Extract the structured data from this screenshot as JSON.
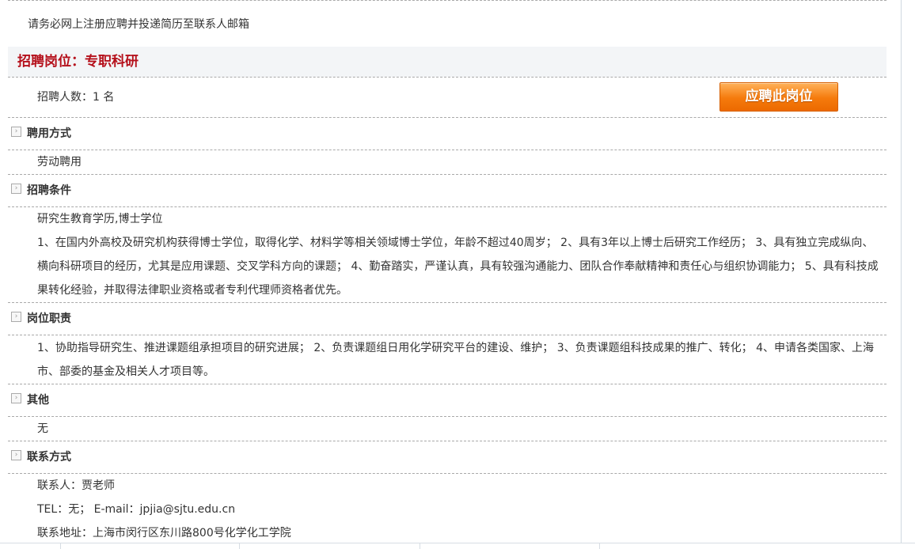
{
  "notice": "请务必网上注册应聘并投递简历至联系人邮箱",
  "job": {
    "title": "招聘岗位：专职科研",
    "count": "招聘人数：1 名",
    "apply_button": "应聘此岗位"
  },
  "sections": {
    "employment": {
      "heading": "聘用方式",
      "text": "劳动聘用"
    },
    "conditions": {
      "heading": "招聘条件",
      "degree": "研究生教育学历,博士学位",
      "text": "1、在国内外高校及研究机构获得博士学位，取得化学、材料学等相关领域博士学位，年龄不超过40周岁； 2、具有3年以上博士后研究工作经历； 3、具有独立完成纵向、横向科研项目的经历，尤其是应用课题、交叉学科方向的课题； 4、勤奋踏实，严谨认真，具有较强沟通能力、团队合作奉献精神和责任心与组织协调能力； 5、具有科技成果转化经验，并取得法律职业资格或者专利代理师资格者优先。"
    },
    "duties": {
      "heading": "岗位职责",
      "text": "1、协助指导研究生、推进课题组承担项目的研究进展； 2、负责课题组日用化学研究平台的建设、维护； 3、负责课题组科技成果的推广、转化； 4、申请各类国家、上海市、部委的基金及相关人才项目等。"
    },
    "other": {
      "heading": "其他",
      "text": "无"
    },
    "contact": {
      "heading": "联系方式",
      "person": "联系人：贾老师",
      "tel_email": "TEL：无； E-mail：jpjia@sjtu.edu.cn",
      "address": "联系地址：上海市闵行区东川路800号化学化工学院"
    }
  },
  "icons": {
    "section_marker": "expand-arrow-icon"
  },
  "colors": {
    "title": "#b5101b",
    "button": "#f57a0c",
    "title_bg": "#f3f5f7"
  }
}
